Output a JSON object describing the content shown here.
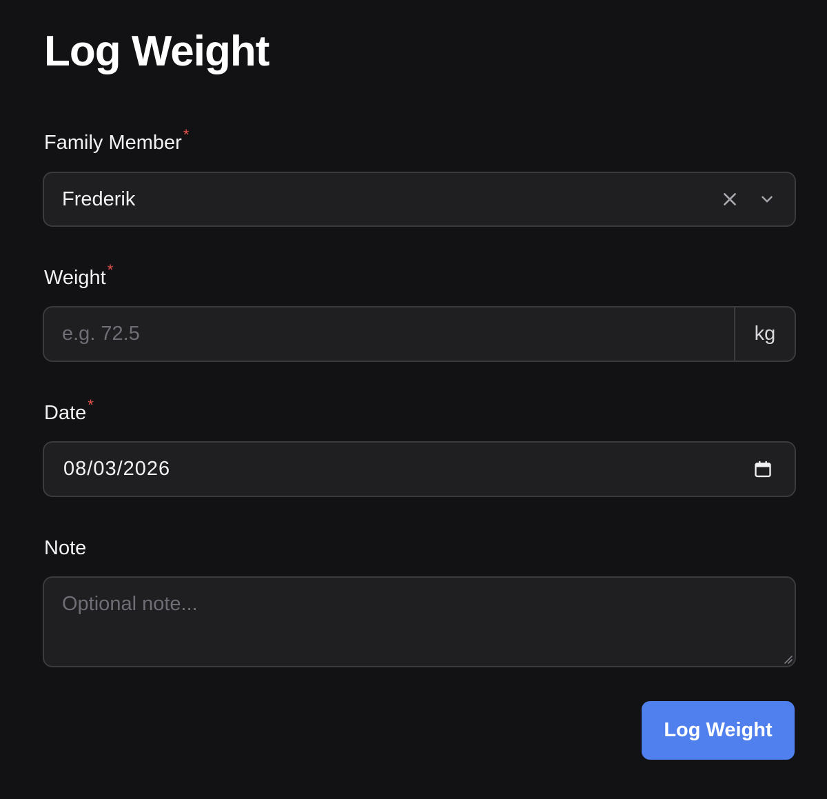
{
  "page": {
    "title": "Log Weight"
  },
  "form": {
    "family_member": {
      "label": "Family Member",
      "required_mark": "*",
      "value": "Frederik",
      "clear_icon": "close-icon",
      "dropdown_icon": "chevron-down-icon"
    },
    "weight": {
      "label": "Weight",
      "required_mark": "*",
      "value": "",
      "placeholder": "e.g. 72.5",
      "unit": "kg"
    },
    "date": {
      "label": "Date",
      "required_mark": "*",
      "value": "08/03/2026",
      "icon": "calendar-icon"
    },
    "note": {
      "label": "Note",
      "value": "",
      "placeholder": "Optional note..."
    },
    "submit_label": "Log Weight"
  },
  "colors": {
    "background": "#121214",
    "field_background": "#1f1f22",
    "field_border": "#3a3a3f",
    "required_mark": "#e5534b",
    "primary_button": "#4f80ee"
  }
}
